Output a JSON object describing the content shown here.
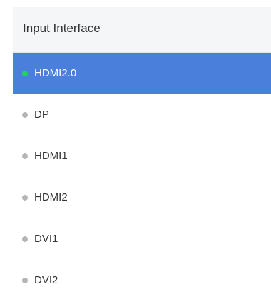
{
  "panel": {
    "title": "Input Interface"
  },
  "items": [
    {
      "label": "HDMI2.0",
      "selected": true,
      "status": "active",
      "status_color": "#22d652"
    },
    {
      "label": "DP",
      "selected": false,
      "status": "inactive",
      "status_color": "#b5b5b5"
    },
    {
      "label": "HDMI1",
      "selected": false,
      "status": "inactive",
      "status_color": "#b5b5b5"
    },
    {
      "label": "HDMI2",
      "selected": false,
      "status": "inactive",
      "status_color": "#b5b5b5"
    },
    {
      "label": "DVI1",
      "selected": false,
      "status": "inactive",
      "status_color": "#b5b5b5"
    },
    {
      "label": "DVI2",
      "selected": false,
      "status": "inactive",
      "status_color": "#b5b5b5"
    }
  ],
  "colors": {
    "selected_background": "#4a7fdb",
    "header_background": "#f5f6f8"
  }
}
